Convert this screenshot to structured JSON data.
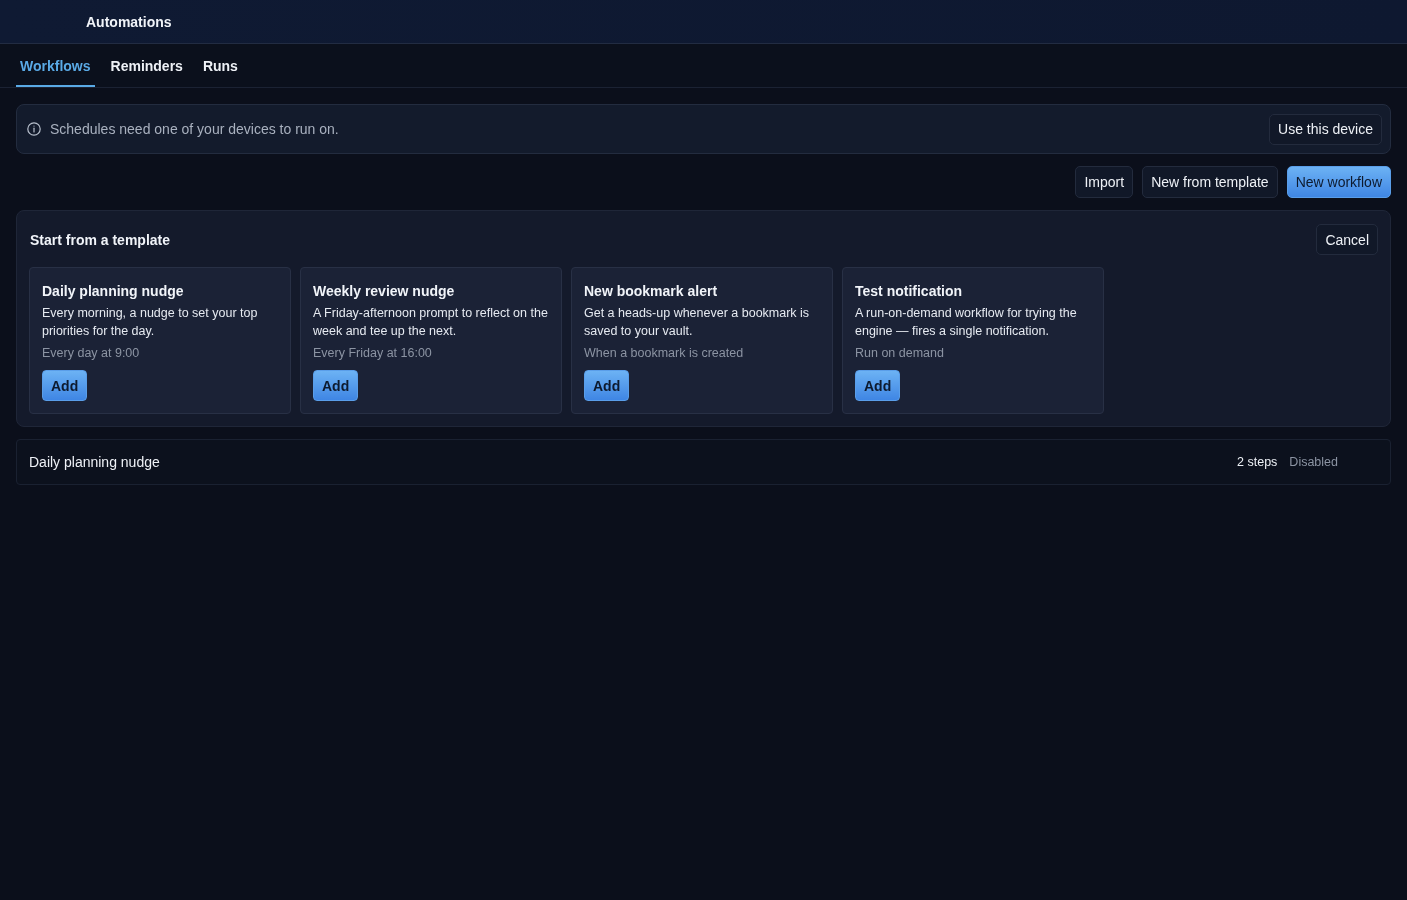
{
  "header": {
    "title": "Automations"
  },
  "tabs": [
    {
      "label": "Workflows",
      "selected": true
    },
    {
      "label": "Reminders",
      "selected": false
    },
    {
      "label": "Runs",
      "selected": false
    }
  ],
  "notice": {
    "text": "Schedules need one of your devices to run on.",
    "action": "Use this device"
  },
  "toolbar": {
    "buttons": [
      {
        "label": "Import",
        "kind": "secondary"
      },
      {
        "label": "New from template",
        "kind": "secondary"
      },
      {
        "label": "New workflow",
        "kind": "primary"
      }
    ]
  },
  "template_panel": {
    "title": "Start from a template",
    "cancel": "Cancel",
    "templates": [
      {
        "name": "Daily planning nudge",
        "description": "Every morning, a nudge to set your top priorities for the day.",
        "schedule": "Every day at 9:00",
        "action": "Add"
      },
      {
        "name": "Weekly review nudge",
        "description": "A Friday-afternoon prompt to reflect on the week and tee up the next.",
        "schedule": "Every Friday at 16:00",
        "action": "Add"
      },
      {
        "name": "New bookmark alert",
        "description": "Get a heads-up whenever a bookmark is saved to your vault.",
        "schedule": "When a bookmark is created",
        "action": "Add"
      },
      {
        "name": "Test notification",
        "description": "A run-on-demand workflow for trying the engine — fires a single notification.",
        "schedule": "Run on demand",
        "action": "Add"
      }
    ]
  },
  "workflows": [
    {
      "name": "Daily planning nudge",
      "steps": "2 steps",
      "status": "Disabled"
    }
  ]
}
